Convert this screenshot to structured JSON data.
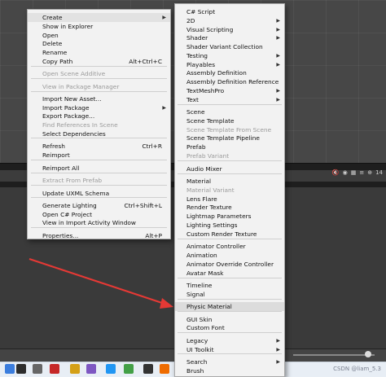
{
  "left_menu": {
    "items": [
      {
        "label": "Create",
        "submenu": true
      },
      {
        "label": "Show in Explorer"
      },
      {
        "label": "Open"
      },
      {
        "label": "Delete"
      },
      {
        "label": "Rename"
      },
      {
        "label": "Copy Path",
        "shortcut": "Alt+Ctrl+C"
      },
      {
        "label": "Open Scene Additive",
        "disabled": true
      },
      {
        "label": "View in Package Manager",
        "disabled": true
      },
      {
        "label": "Import New Asset..."
      },
      {
        "label": "Import Package",
        "submenu": true
      },
      {
        "label": "Export Package..."
      },
      {
        "label": "Find References In Scene",
        "disabled": true
      },
      {
        "label": "Select Dependencies"
      },
      {
        "label": "Refresh",
        "shortcut": "Ctrl+R"
      },
      {
        "label": "Reimport"
      },
      {
        "label": "Reimport All"
      },
      {
        "label": "Extract From Prefab",
        "disabled": true
      },
      {
        "label": "Update UXML Schema"
      },
      {
        "label": "Generate Lighting",
        "shortcut": "Ctrl+Shift+L"
      },
      {
        "label": "Open C# Project"
      },
      {
        "label": "View in Import Activity Window"
      },
      {
        "label": "Properties...",
        "shortcut": "Alt+P"
      }
    ]
  },
  "right_menu": {
    "items": [
      {
        "label": "C# Script"
      },
      {
        "label": "2D",
        "submenu": true
      },
      {
        "label": "Visual Scripting",
        "submenu": true
      },
      {
        "label": "Shader",
        "submenu": true
      },
      {
        "label": "Shader Variant Collection"
      },
      {
        "label": "Testing",
        "submenu": true
      },
      {
        "label": "Playables",
        "submenu": true
      },
      {
        "label": "Assembly Definition"
      },
      {
        "label": "Assembly Definition Reference"
      },
      {
        "label": "TextMeshPro",
        "submenu": true
      },
      {
        "label": "Text",
        "submenu": true
      },
      {
        "label": "Scene"
      },
      {
        "label": "Scene Template"
      },
      {
        "label": "Scene Template From Scene",
        "disabled": true
      },
      {
        "label": "Scene Template Pipeline"
      },
      {
        "label": "Prefab"
      },
      {
        "label": "Prefab Variant",
        "disabled": true
      },
      {
        "label": "Audio Mixer"
      },
      {
        "label": "Material"
      },
      {
        "label": "Material Variant",
        "disabled": true
      },
      {
        "label": "Lens Flare"
      },
      {
        "label": "Render Texture"
      },
      {
        "label": "Lightmap Parameters"
      },
      {
        "label": "Lighting Settings"
      },
      {
        "label": "Custom Render Texture"
      },
      {
        "label": "Animator Controller"
      },
      {
        "label": "Animation"
      },
      {
        "label": "Animator Override Controller"
      },
      {
        "label": "Avatar Mask"
      },
      {
        "label": "Timeline"
      },
      {
        "label": "Signal"
      },
      {
        "label": "Physic Material",
        "selected": true
      },
      {
        "label": "GUI Skin"
      },
      {
        "label": "Custom Font"
      },
      {
        "label": "Legacy",
        "submenu": true
      },
      {
        "label": "UI Toolkit",
        "submenu": true
      },
      {
        "label": "Search",
        "submenu": true
      },
      {
        "label": "Brush"
      }
    ]
  },
  "toolbar": {
    "gizmo_count": "14"
  },
  "watermark": "CSDN @liam_5.3",
  "colors": {
    "menu_bg": "#f2f2f2",
    "arrow": "#e53935",
    "editor_bg": "#474747"
  },
  "icons": [
    "audio-icon",
    "eye-icon",
    "grid-icon",
    "layers-icon",
    "gizmos-icon"
  ]
}
